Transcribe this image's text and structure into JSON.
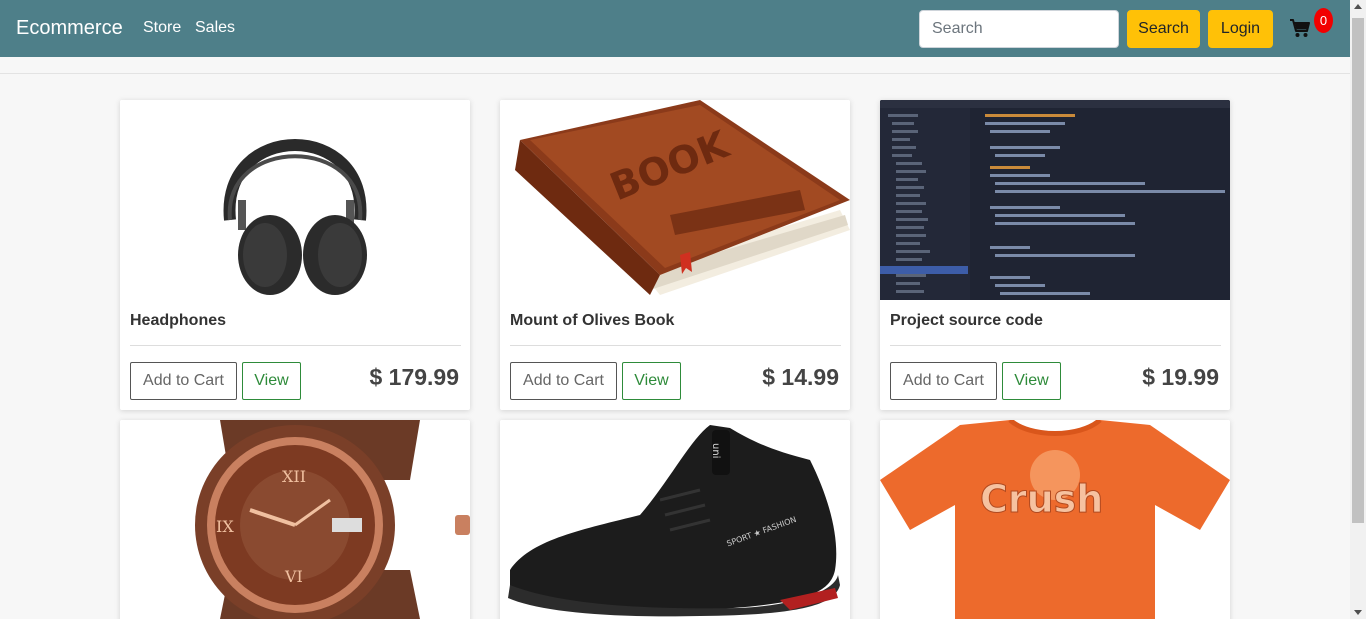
{
  "navbar": {
    "brand": "Ecommerce",
    "links": [
      "Store",
      "Sales"
    ],
    "search_placeholder": "Search",
    "search_button": "Search",
    "login_button": "Login",
    "cart_count": "0"
  },
  "colors": {
    "navbar": "#4e7f89",
    "accent_yellow": "#ffc107",
    "view_green": "#2e8b3a",
    "badge_red": "#f20000"
  },
  "products": [
    {
      "title": "Headphones",
      "price": "$ 179.99",
      "image_icon": "headphones-image"
    },
    {
      "title": "Mount of Olives Book",
      "price": "$ 14.99",
      "image_icon": "book-image"
    },
    {
      "title": "Project source code",
      "price": "$ 19.99",
      "image_icon": "source-code-image"
    },
    {
      "title": "",
      "price": "",
      "image_icon": "watch-image"
    },
    {
      "title": "",
      "price": "",
      "image_icon": "sneaker-image"
    },
    {
      "title": "",
      "price": "",
      "image_icon": "tshirt-image"
    }
  ],
  "card_buttons": {
    "add_to_cart": "Add to Cart",
    "view": "View"
  },
  "images": {
    "book_cover_text": "BOOK",
    "tshirt_text": "Crush"
  }
}
